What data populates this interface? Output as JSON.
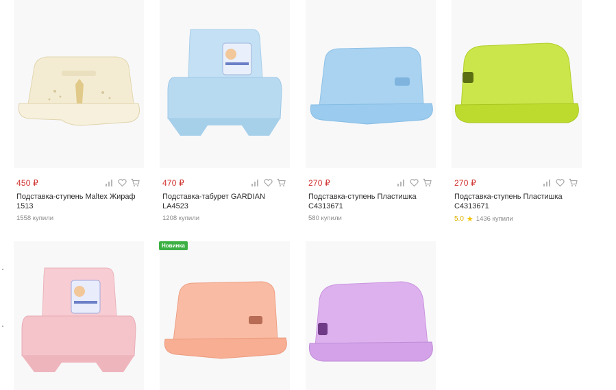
{
  "currency": "₽",
  "products": [
    {
      "price": "450 ₽",
      "title": "Подставка-ступень Maltex Жираф 1513",
      "bought": "1558 купили",
      "color": "#f1e7c9",
      "image_icon": "beige-step-stool-icon"
    },
    {
      "price": "470 ₽",
      "title": "Подставка-табурет GARDIAN LA4523",
      "bought": "1208 купили",
      "color": "#bcdcf1",
      "image_icon": "blue-two-step-stool-icon"
    },
    {
      "price": "270 ₽",
      "title": "Подставка-ступень Пластишка С4313671",
      "bought": "580 купили",
      "color": "#9fcdee",
      "image_icon": "blue-step-stool-icon"
    },
    {
      "price": "270 ₽",
      "title": "Подставка-ступень Пластишка С4313671",
      "bought": "1436 купили",
      "rating": "5.0",
      "color": "#c6e33a",
      "image_icon": "green-step-stool-icon"
    },
    {
      "color": "#f6c6cc",
      "image_icon": "pink-two-step-stool-icon"
    },
    {
      "badge": "Новинка",
      "color": "#f9b89e",
      "image_icon": "peach-step-stool-icon"
    },
    {
      "color": "#d8aaea",
      "image_icon": "lilac-step-stool-icon"
    }
  ],
  "icons": {
    "compare": "compare-icon",
    "favorite": "heart-icon",
    "cart": "cart-icon"
  },
  "colors": {
    "price": "#d0312d",
    "badge": "#3cb043",
    "star": "#f2c200"
  }
}
